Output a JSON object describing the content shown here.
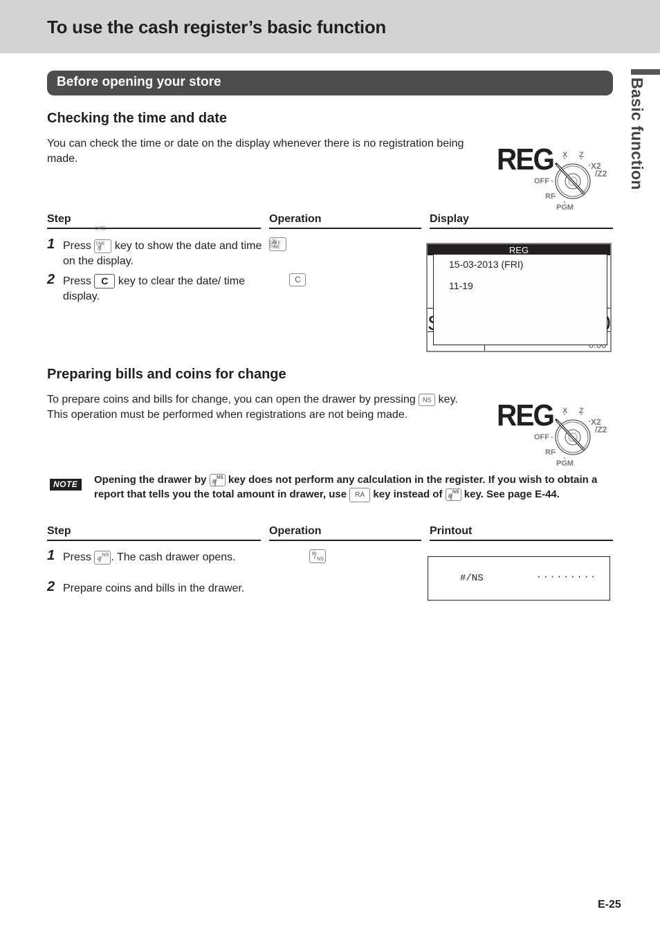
{
  "header": {
    "title": "To use the cash register’s basic function"
  },
  "side_tab": {
    "label": "Basic function"
  },
  "section": {
    "title": "Before opening your store"
  },
  "mode_indicator": {
    "mode": "REG",
    "positions": [
      "X",
      "Z",
      "X2",
      "/Z2",
      "OFF",
      "RF",
      "PGM"
    ]
  },
  "checking_time": {
    "heading": "Checking the time and date",
    "description": "You can check the time or date on the display whenever there is no registration being made.",
    "columns": {
      "step": "Step",
      "operation": "Operation",
      "display": "Display"
    },
    "steps": [
      {
        "number": "1",
        "text_before": "Press",
        "key": {
          "top": "X",
          "bottom": "DATE TIME"
        },
        "text_after": "key to show the date and time on the display."
      },
      {
        "number": "2",
        "text_before": "Press",
        "key": {
          "label": "C"
        },
        "text_after": "key to clear the date/ time display."
      }
    ],
    "operation_keys": [
      {
        "top": "X",
        "bottom": "DATE TIME"
      },
      {
        "label": "C"
      }
    ],
    "display": {
      "mode_bar": "REG",
      "date_line": "15-03-2013 (FRI)",
      "time_line": "11-19",
      "behind_left": "S",
      "behind_right": "0",
      "behind_bottom_value": "0.00"
    }
  },
  "preparing_change": {
    "heading": "Preparing bills and coins for change",
    "description_before": "To prepare coins and bills for change, you can open the drawer by pressing",
    "description_key": "NS",
    "description_after": "key. This operation must be performed when registrations are not being made.",
    "note": {
      "badge": "NOTE",
      "text_1": "Opening the drawer by",
      "key_1": {
        "top": "#",
        "bottom": "NS"
      },
      "text_2": "key does not perform any calculation in the register. If you wish to obtain a report that tells you the total amount in drawer, use",
      "key_2": "RA",
      "text_3": "key instead of",
      "key_3": {
        "top": "#",
        "bottom": "NS"
      },
      "text_4": "key. See page E-44."
    },
    "columns": {
      "step": "Step",
      "operation": "Operation",
      "printout": "Printout"
    },
    "steps": [
      {
        "number": "1",
        "text_before": "Press",
        "key": {
          "top": "#",
          "bottom": "NS"
        },
        "text_after": ". The cash drawer opens."
      },
      {
        "number": "2",
        "text": "Prepare coins and bills in the drawer."
      }
    ],
    "operation_keys": [
      {
        "top": "#",
        "bottom": "NS"
      }
    ],
    "printout": {
      "label": "#/NS",
      "dots": "·········"
    }
  },
  "footer": {
    "page_number": "E-25"
  }
}
